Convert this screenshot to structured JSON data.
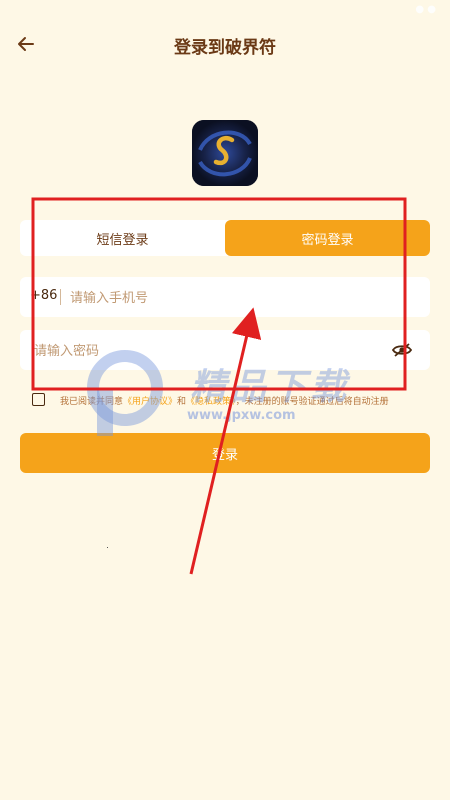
{
  "header": {
    "title": "登录到破界符"
  },
  "tabs": [
    {
      "label": "短信登录"
    },
    {
      "label": "密码登录"
    }
  ],
  "phone": {
    "prefix": "+86",
    "placeholder": "请输入手机号",
    "value": ""
  },
  "password": {
    "placeholder": "请输入密码",
    "value": ""
  },
  "agreement": {
    "prefix": "我已阅读并同意",
    "user_agreement": "《用户协议》",
    "and": "和",
    "privacy_policy": "《隐私政策》",
    "suffix": "，未注册的账号验证通过后将自动注册"
  },
  "login_button": "登录",
  "watermark": {
    "text": "精品下载",
    "url": "www.jpxw.com"
  },
  "colors": {
    "accent": "#F5A31A",
    "background": "#FEF8E6",
    "text": "#6B3A16",
    "annotation": "#E02020"
  }
}
